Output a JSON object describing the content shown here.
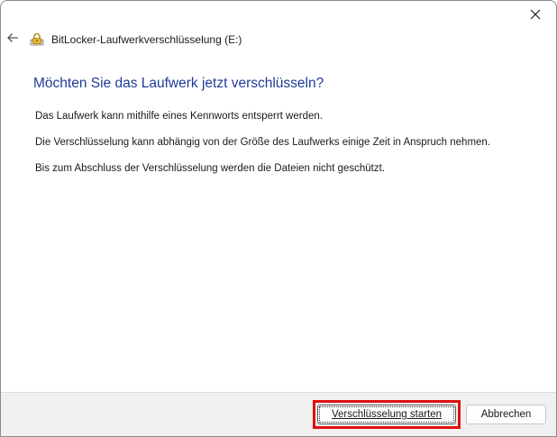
{
  "window": {
    "title": "BitLocker-Laufwerkverschlüsselung (E:)"
  },
  "content": {
    "heading": "Möchten Sie das Laufwerk jetzt verschlüsseln?",
    "paragraphs": [
      "Das Laufwerk kann mithilfe eines Kennworts entsperrt werden.",
      "Die Verschlüsselung kann abhängig von der Größe des Laufwerks einige Zeit in Anspruch nehmen.",
      "Bis zum Abschluss der Verschlüsselung werden die Dateien nicht geschützt."
    ]
  },
  "footer": {
    "start_label": "Verschlüsselung starten",
    "cancel_label": "Abbrechen"
  },
  "icons": {
    "close": "close-icon",
    "back": "back-arrow-icon",
    "app": "bitlocker-drive-icon"
  },
  "colors": {
    "heading": "#1e3c96",
    "highlight": "#e01010",
    "footer_bg": "#f0f0f0"
  }
}
